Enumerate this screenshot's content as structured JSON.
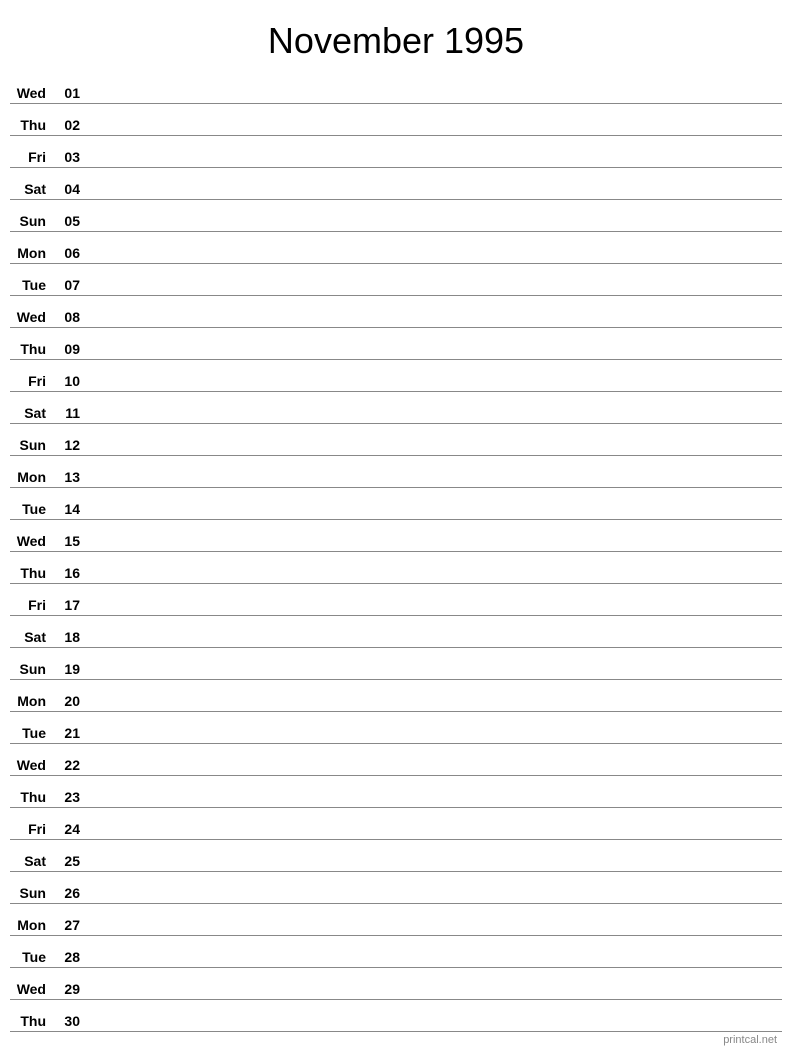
{
  "title": "November 1995",
  "footer": "printcal.net",
  "days": [
    {
      "name": "Wed",
      "number": "01"
    },
    {
      "name": "Thu",
      "number": "02"
    },
    {
      "name": "Fri",
      "number": "03"
    },
    {
      "name": "Sat",
      "number": "04"
    },
    {
      "name": "Sun",
      "number": "05"
    },
    {
      "name": "Mon",
      "number": "06"
    },
    {
      "name": "Tue",
      "number": "07"
    },
    {
      "name": "Wed",
      "number": "08"
    },
    {
      "name": "Thu",
      "number": "09"
    },
    {
      "name": "Fri",
      "number": "10"
    },
    {
      "name": "Sat",
      "number": "11"
    },
    {
      "name": "Sun",
      "number": "12"
    },
    {
      "name": "Mon",
      "number": "13"
    },
    {
      "name": "Tue",
      "number": "14"
    },
    {
      "name": "Wed",
      "number": "15"
    },
    {
      "name": "Thu",
      "number": "16"
    },
    {
      "name": "Fri",
      "number": "17"
    },
    {
      "name": "Sat",
      "number": "18"
    },
    {
      "name": "Sun",
      "number": "19"
    },
    {
      "name": "Mon",
      "number": "20"
    },
    {
      "name": "Tue",
      "number": "21"
    },
    {
      "name": "Wed",
      "number": "22"
    },
    {
      "name": "Thu",
      "number": "23"
    },
    {
      "name": "Fri",
      "number": "24"
    },
    {
      "name": "Sat",
      "number": "25"
    },
    {
      "name": "Sun",
      "number": "26"
    },
    {
      "name": "Mon",
      "number": "27"
    },
    {
      "name": "Tue",
      "number": "28"
    },
    {
      "name": "Wed",
      "number": "29"
    },
    {
      "name": "Thu",
      "number": "30"
    }
  ]
}
